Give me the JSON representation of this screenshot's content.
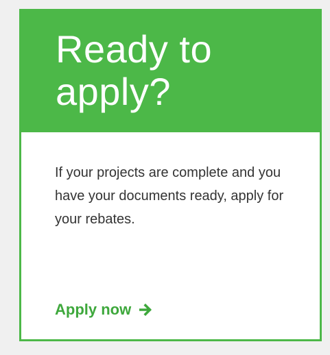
{
  "card": {
    "title_line1": "Ready to",
    "title_line2": "apply?",
    "body_text": "If your projects are complete and you have your documents ready, apply for your rebates.",
    "cta_label": "Apply now",
    "cta_icon": "arrow-right-icon"
  },
  "colors": {
    "accent": "#4cb848",
    "link": "#3ea83c",
    "body_text": "#333333",
    "page_background": "#f0f0f0"
  }
}
